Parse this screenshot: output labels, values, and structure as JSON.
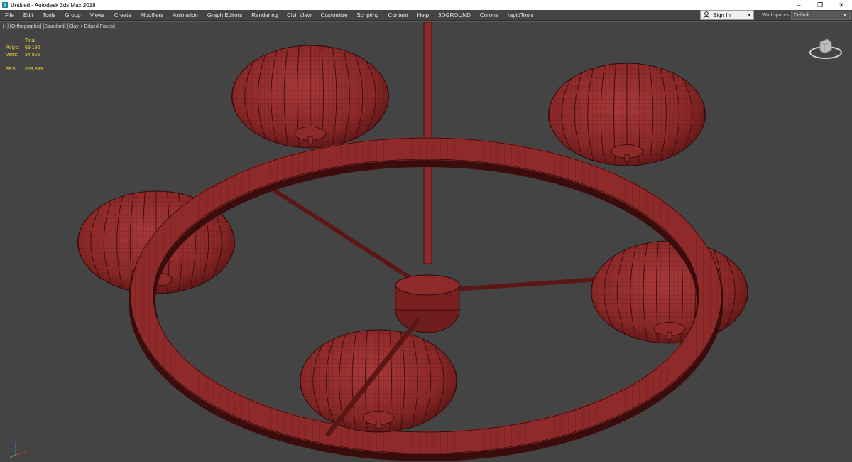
{
  "titlebar": {
    "title": "Untitled - Autodesk 3ds Max 2018",
    "minimize": "–",
    "restore": "❐",
    "close": "✕"
  },
  "menu": [
    "File",
    "Edit",
    "Tools",
    "Group",
    "Views",
    "Create",
    "Modifiers",
    "Animation",
    "Graph Editors",
    "Rendering",
    "Civil View",
    "Customize",
    "Scripting",
    "Content",
    "Help",
    "3DGROUND",
    "Corona",
    "rapidTools"
  ],
  "signin": {
    "label": "Sign In",
    "caret": "▼"
  },
  "workspaces": {
    "label": "Workspaces:",
    "value": "Default",
    "caret": "▼"
  },
  "viewport": {
    "label_parts": [
      "[+]",
      "[Orthographic]",
      "[Standard]",
      "[Clay + Edged Faces]"
    ],
    "stats": {
      "header": "Total",
      "polys_label": "Polys:",
      "polys_value": "69 192",
      "verts_label": "Verts:",
      "verts_value": "34 806",
      "fps_label": "FPS:",
      "fps_value": "553,833"
    }
  },
  "colors": {
    "viewport_bg": "#444444",
    "model_fill": "#8f2a2a",
    "model_dark": "#5d1616",
    "wire": "#2b0a0a",
    "stats_text": "#e0d23a"
  },
  "icons": [
    "app-icon",
    "user-icon",
    "viewcube-icon",
    "axis-tripod-icon"
  ]
}
